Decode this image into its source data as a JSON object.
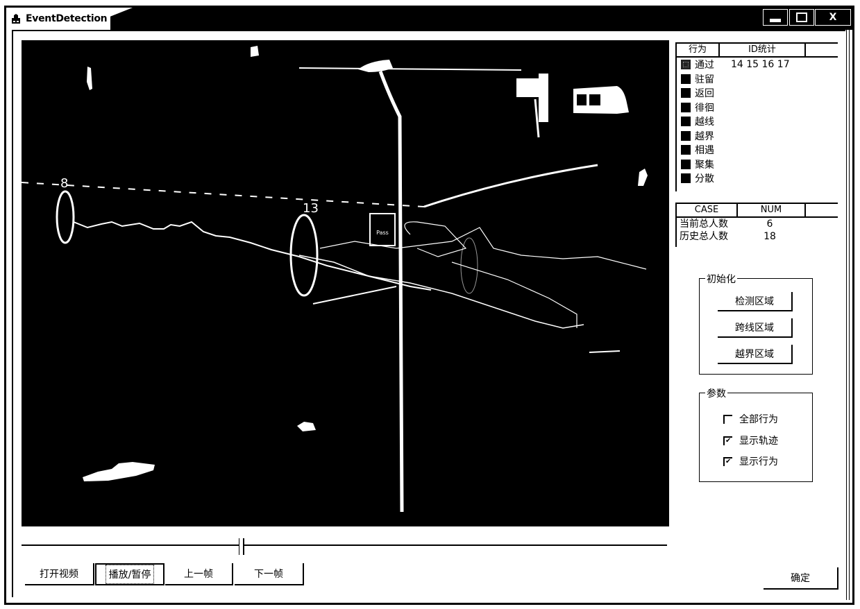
{
  "window": {
    "title": "EventDetection",
    "app_icon": "app-icon",
    "controls": {
      "minimize": "minimize-icon",
      "maximize": "maximize-icon",
      "close_label": "X"
    }
  },
  "video": {
    "track_labels": [
      {
        "id": "8"
      },
      {
        "id": "13"
      }
    ],
    "sign_text": "Pass"
  },
  "playback": {
    "slider_position_fraction": 0.337
  },
  "buttons": {
    "open_video": "打开视频",
    "play_pause": "播放/暂停",
    "prev_frame": "上一帧",
    "next_frame": "下一帧",
    "confirm": "确定"
  },
  "behavior_table": {
    "headers": [
      "行为",
      "ID统计",
      ""
    ],
    "rows": [
      {
        "label": "通过",
        "ids": "14 15 16 17",
        "swatch": "dotted"
      },
      {
        "label": "驻留",
        "ids": "",
        "swatch": "solid"
      },
      {
        "label": "返回",
        "ids": "",
        "swatch": "solid"
      },
      {
        "label": "徘徊",
        "ids": "",
        "swatch": "solid"
      },
      {
        "label": "越线",
        "ids": "",
        "swatch": "solid"
      },
      {
        "label": "越界",
        "ids": "",
        "swatch": "solid"
      },
      {
        "label": "相遇",
        "ids": "",
        "swatch": "solid"
      },
      {
        "label": "聚集",
        "ids": "",
        "swatch": "solid"
      },
      {
        "label": "分散",
        "ids": "",
        "swatch": "solid"
      }
    ]
  },
  "case_table": {
    "headers": [
      "CASE",
      "NUM",
      ""
    ],
    "rows": [
      {
        "case": "当前总人数",
        "num": "6"
      },
      {
        "case": "历史总人数",
        "num": "18"
      }
    ]
  },
  "init_group": {
    "title": "初始化",
    "buttons": [
      "检测区域",
      "跨线区域",
      "越界区域"
    ]
  },
  "params_group": {
    "title": "参数",
    "checkboxes": [
      {
        "label": "全部行为",
        "checked": false
      },
      {
        "label": "显示轨迹",
        "checked": true
      },
      {
        "label": "显示行为",
        "checked": true
      }
    ]
  }
}
